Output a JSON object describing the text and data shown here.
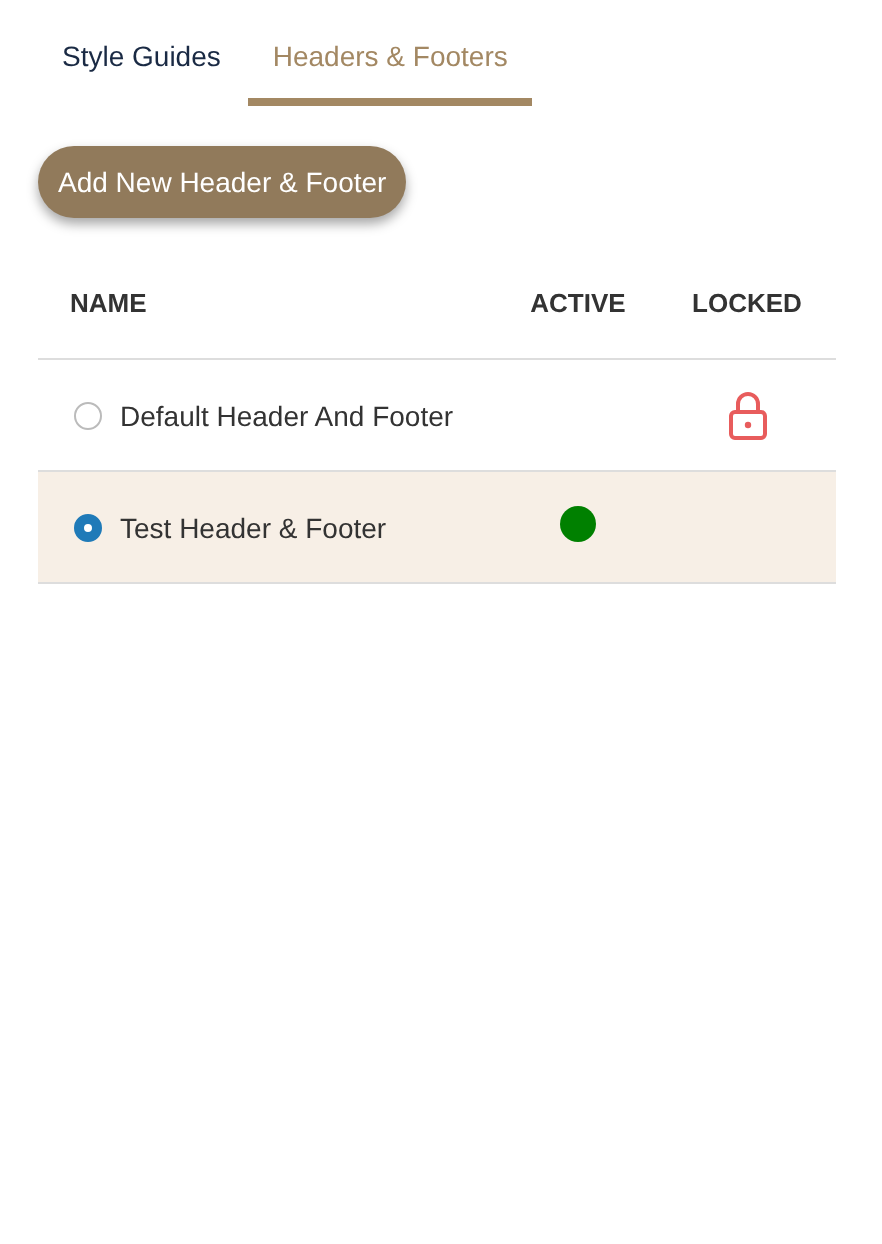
{
  "tabs": [
    {
      "label": "Style Guides",
      "selected": false
    },
    {
      "label": "Headers & Footers",
      "selected": true
    }
  ],
  "add_button": "Add New Header & Footer",
  "table": {
    "columns": [
      "NAME",
      "ACTIVE",
      "LOCKED"
    ],
    "rows": [
      {
        "name": "Default Header And Footer",
        "selected": false,
        "active": false,
        "locked": true
      },
      {
        "name": "Test Header & Footer",
        "selected": true,
        "active": true,
        "locked": false
      }
    ]
  }
}
